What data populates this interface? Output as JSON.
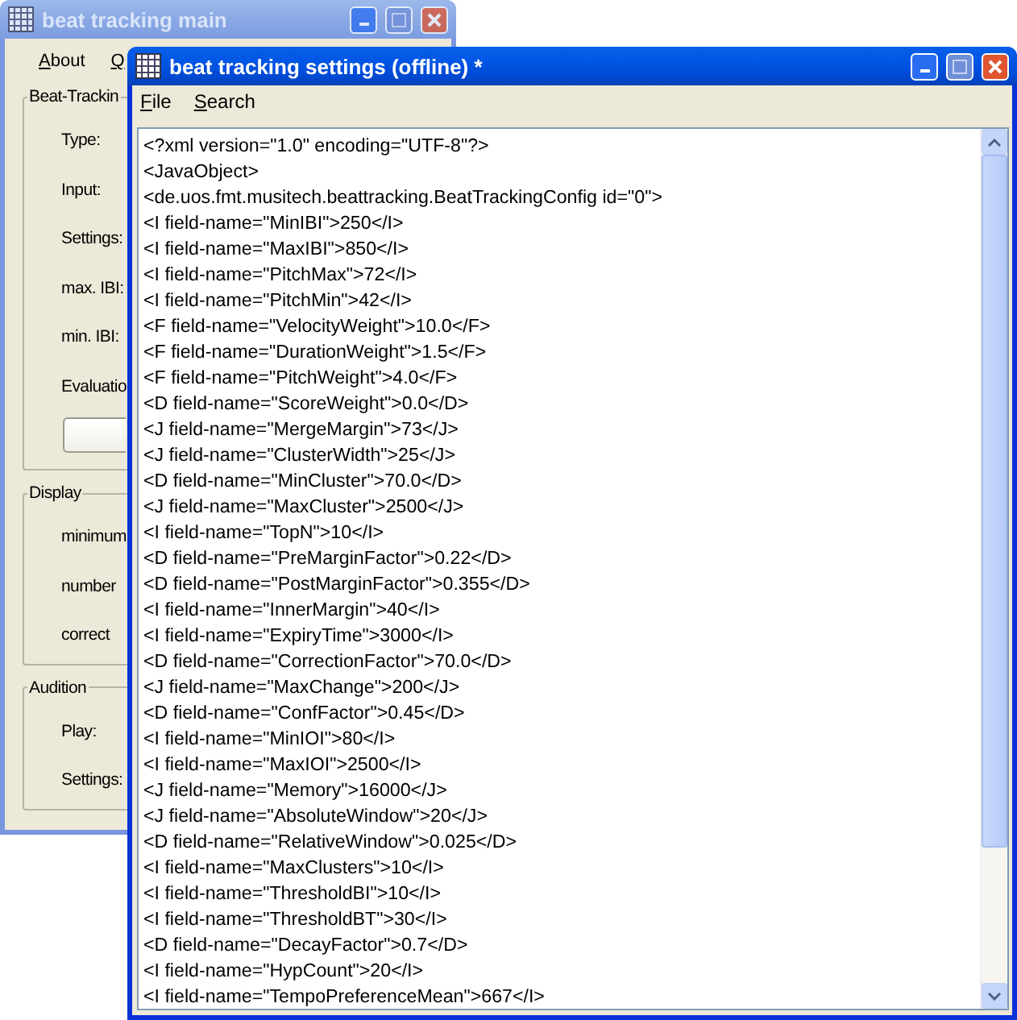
{
  "back_window": {
    "title": "beat tracking main",
    "active": false,
    "menu": [
      "About",
      "Q"
    ],
    "groups": [
      {
        "title": "Beat-Trackin",
        "items": [
          {
            "kind": "label",
            "text": "Type:"
          },
          {
            "kind": "label",
            "text": "Input:"
          },
          {
            "kind": "label",
            "text": "Settings:"
          },
          {
            "kind": "label",
            "text": "max. IBI:"
          },
          {
            "kind": "label",
            "text": "min. IBI:"
          },
          {
            "kind": "label",
            "text": "Evaluatio"
          },
          {
            "kind": "button"
          }
        ]
      },
      {
        "title": "Display",
        "items": [
          {
            "kind": "label",
            "text": "minimum"
          },
          {
            "kind": "label",
            "text": "number"
          },
          {
            "kind": "label",
            "text": "correct"
          }
        ]
      },
      {
        "title": "Audition",
        "items": [
          {
            "kind": "label",
            "text": "Play:"
          },
          {
            "kind": "label",
            "text": "Settings:"
          }
        ]
      }
    ]
  },
  "front_window": {
    "title": "beat tracking settings (offline) *",
    "active": true,
    "menu": [
      "File",
      "Search"
    ],
    "lines": [
      "<?xml version=\"1.0\" encoding=\"UTF-8\"?>",
      "<JavaObject>",
      "<de.uos.fmt.musitech.beattracking.BeatTrackingConfig id=\"0\">",
      "<I field-name=\"MinIBI\">250</I>",
      "<I field-name=\"MaxIBI\">850</I>",
      "<I field-name=\"PitchMax\">72</I>",
      "<I field-name=\"PitchMin\">42</I>",
      "<F field-name=\"VelocityWeight\">10.0</F>",
      "<F field-name=\"DurationWeight\">1.5</F>",
      "<F field-name=\"PitchWeight\">4.0</F>",
      "<D field-name=\"ScoreWeight\">0.0</D>",
      "<J field-name=\"MergeMargin\">73</J>",
      "<J field-name=\"ClusterWidth\">25</J>",
      "<D field-name=\"MinCluster\">70.0</D>",
      "<J field-name=\"MaxCluster\">2500</J>",
      "<I field-name=\"TopN\">10</I>",
      "<D field-name=\"PreMarginFactor\">0.22</D>",
      "<D field-name=\"PostMarginFactor\">0.355</D>",
      "<I field-name=\"InnerMargin\">40</I>",
      "<I field-name=\"ExpiryTime\">3000</I>",
      "<D field-name=\"CorrectionFactor\">70.0</D>",
      "<J field-name=\"MaxChange\">200</J>",
      "<D field-name=\"ConfFactor\">0.45</D>",
      "<I field-name=\"MinIOI\">80</I>",
      "<I field-name=\"MaxIOI\">2500</I>",
      "<J field-name=\"Memory\">16000</J>",
      "<J field-name=\"AbsoluteWindow\">20</J>",
      "<D field-name=\"RelativeWindow\">0.025</D>",
      "<I field-name=\"MaxClusters\">10</I>",
      "<I field-name=\"ThresholdBI\">10</I>",
      "<I field-name=\"ThresholdBT\">30</I>",
      "<D field-name=\"DecayFactor\">0.7</D>",
      "<I field-name=\"HypCount\">20</I>",
      "<I field-name=\"TempoPreferenceMean\">667</I>"
    ]
  }
}
